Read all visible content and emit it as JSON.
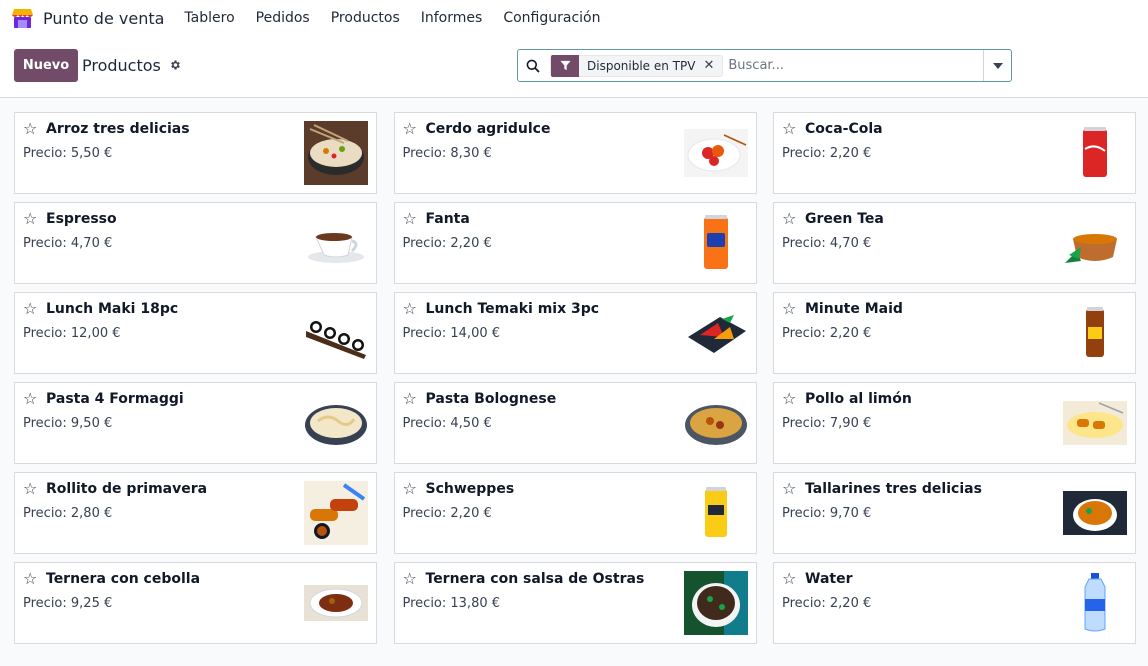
{
  "app": {
    "title": "Punto de venta"
  },
  "nav": [
    {
      "label": "Tablero"
    },
    {
      "label": "Pedidos"
    },
    {
      "label": "Productos"
    },
    {
      "label": "Informes"
    },
    {
      "label": "Configuración"
    }
  ],
  "control": {
    "new_label": "Nuevo",
    "breadcrumb": "Productos"
  },
  "search": {
    "facet": "Disponible en TPV",
    "placeholder": "Buscar..."
  },
  "products": [
    {
      "name": "Arroz tres delicias",
      "price": "Precio: 5,50 €",
      "image": "rice-bowl"
    },
    {
      "name": "Cerdo agridulce",
      "price": "Precio: 8,30 €",
      "image": "pork-plate"
    },
    {
      "name": "Coca-Cola",
      "price": "Precio: 2,20 €",
      "image": "red-can"
    },
    {
      "name": "Espresso",
      "price": "Precio: 4,70 €",
      "image": "coffee-cup"
    },
    {
      "name": "Fanta",
      "price": "Precio: 2,20 €",
      "image": "orange-can"
    },
    {
      "name": "Green Tea",
      "price": "Precio: 4,70 €",
      "image": "tea-cup"
    },
    {
      "name": "Lunch Maki 18pc",
      "price": "Precio: 12,00 €",
      "image": "sushi-boat"
    },
    {
      "name": "Lunch Temaki mix 3pc",
      "price": "Precio: 14,00 €",
      "image": "temaki-plate"
    },
    {
      "name": "Minute Maid",
      "price": "Precio: 2,20 €",
      "image": "brown-can"
    },
    {
      "name": "Pasta 4 Formaggi",
      "price": "Precio: 9,50 €",
      "image": "pasta-bowl"
    },
    {
      "name": "Pasta Bolognese",
      "price": "Precio: 4,50 €",
      "image": "bolognese-bowl"
    },
    {
      "name": "Pollo al limón",
      "price": "Precio: 7,90 €",
      "image": "chicken-plate"
    },
    {
      "name": "Rollito de primavera",
      "price": "Precio: 2,80 €",
      "image": "spring-rolls"
    },
    {
      "name": "Schweppes",
      "price": "Precio: 2,20 €",
      "image": "yellow-can"
    },
    {
      "name": "Tallarines tres delicias",
      "price": "Precio: 9,70 €",
      "image": "noodles-bowl"
    },
    {
      "name": "Ternera con cebolla",
      "price": "Precio: 9,25 €",
      "image": "beef-plate"
    },
    {
      "name": "Ternera con salsa de Ostras",
      "price": "Precio: 13,80 €",
      "image": "beef-bowl"
    },
    {
      "name": "Water",
      "price": "Precio: 2,20 €",
      "image": "water-bottle"
    }
  ],
  "colors": {
    "brand": "#714b67",
    "accent": "#5d9ba1"
  }
}
